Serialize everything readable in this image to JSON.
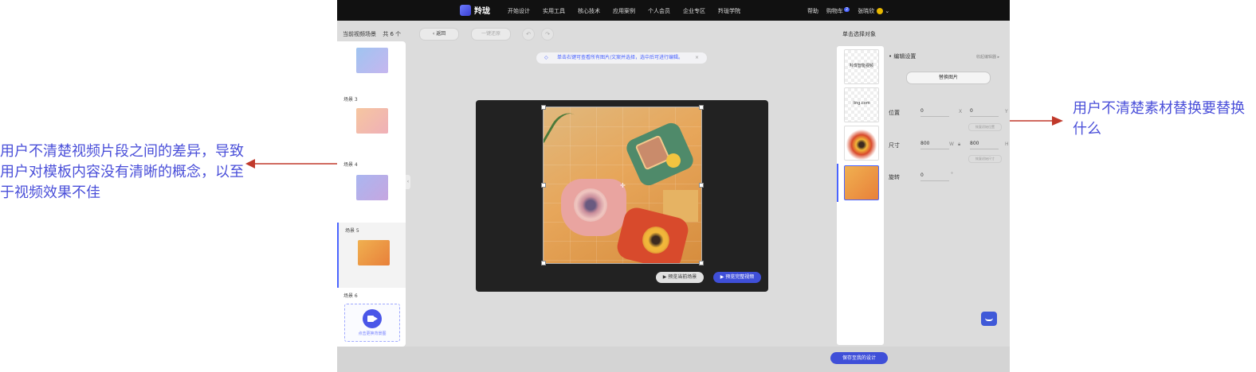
{
  "annotations": {
    "left": "用户不清楚视频片段之间的差异，导致用户对模板内容没有清晰的概念，以至于视频效果不佳",
    "right": "用户不清楚素材替换要替换什么"
  },
  "topbar": {
    "logo": "羚珑",
    "nav": [
      "开始设计",
      "实用工具",
      "核心技术",
      "应用案例",
      "个人会员",
      "企业专区",
      "羚珑学院"
    ],
    "help": "帮助",
    "cart": "购物车",
    "cart_count": "2",
    "user": "张晓欣"
  },
  "left_panel": {
    "header": "当前视频场景",
    "count": "共 6 个",
    "scenes": [
      {
        "label": ""
      },
      {
        "label": "场景 3"
      },
      {
        "label": "场景 4"
      },
      {
        "label": "场景 5"
      },
      {
        "label": "场景 6"
      }
    ],
    "upload_text": "点击更换背景图"
  },
  "toolbar": {
    "back": "返回",
    "restore": "一键还原",
    "undo": "↶",
    "redo": "↷"
  },
  "hint": {
    "text": "单击右键可查看所有图片/文案并选择，选中后可进行编辑。",
    "close": "×"
  },
  "canvas": {
    "preview_current": "预览当前场景",
    "preview_full": "预览完整视频"
  },
  "right_panel": {
    "header": "单击选择对象",
    "assets": [
      {
        "text": "羚珑智能视频"
      },
      {
        "text": "ling.com"
      },
      {
        "text": ""
      },
      {
        "text": ""
      }
    ]
  },
  "props": {
    "header": "• 编辑设置",
    "more": "收起编辑器 ▸",
    "replace": "替换图片",
    "position_label": "位置",
    "x": "0",
    "x_unit": "X",
    "y": "0",
    "y_unit": "Y",
    "reset_pos": "恢复初始位置",
    "size_label": "尺寸",
    "w": "800",
    "w_unit": "W",
    "h": "800",
    "h_unit": "H",
    "reset_size": "恢复初始尺寸",
    "rotate_label": "旋转",
    "rotate": "0",
    "rotate_unit": "°"
  },
  "footer": {
    "save": "保存至我的设计"
  },
  "colors": {
    "accent": "#3f4fd8",
    "annotation": "#4a4fd9",
    "arrow": "#c0392b"
  }
}
